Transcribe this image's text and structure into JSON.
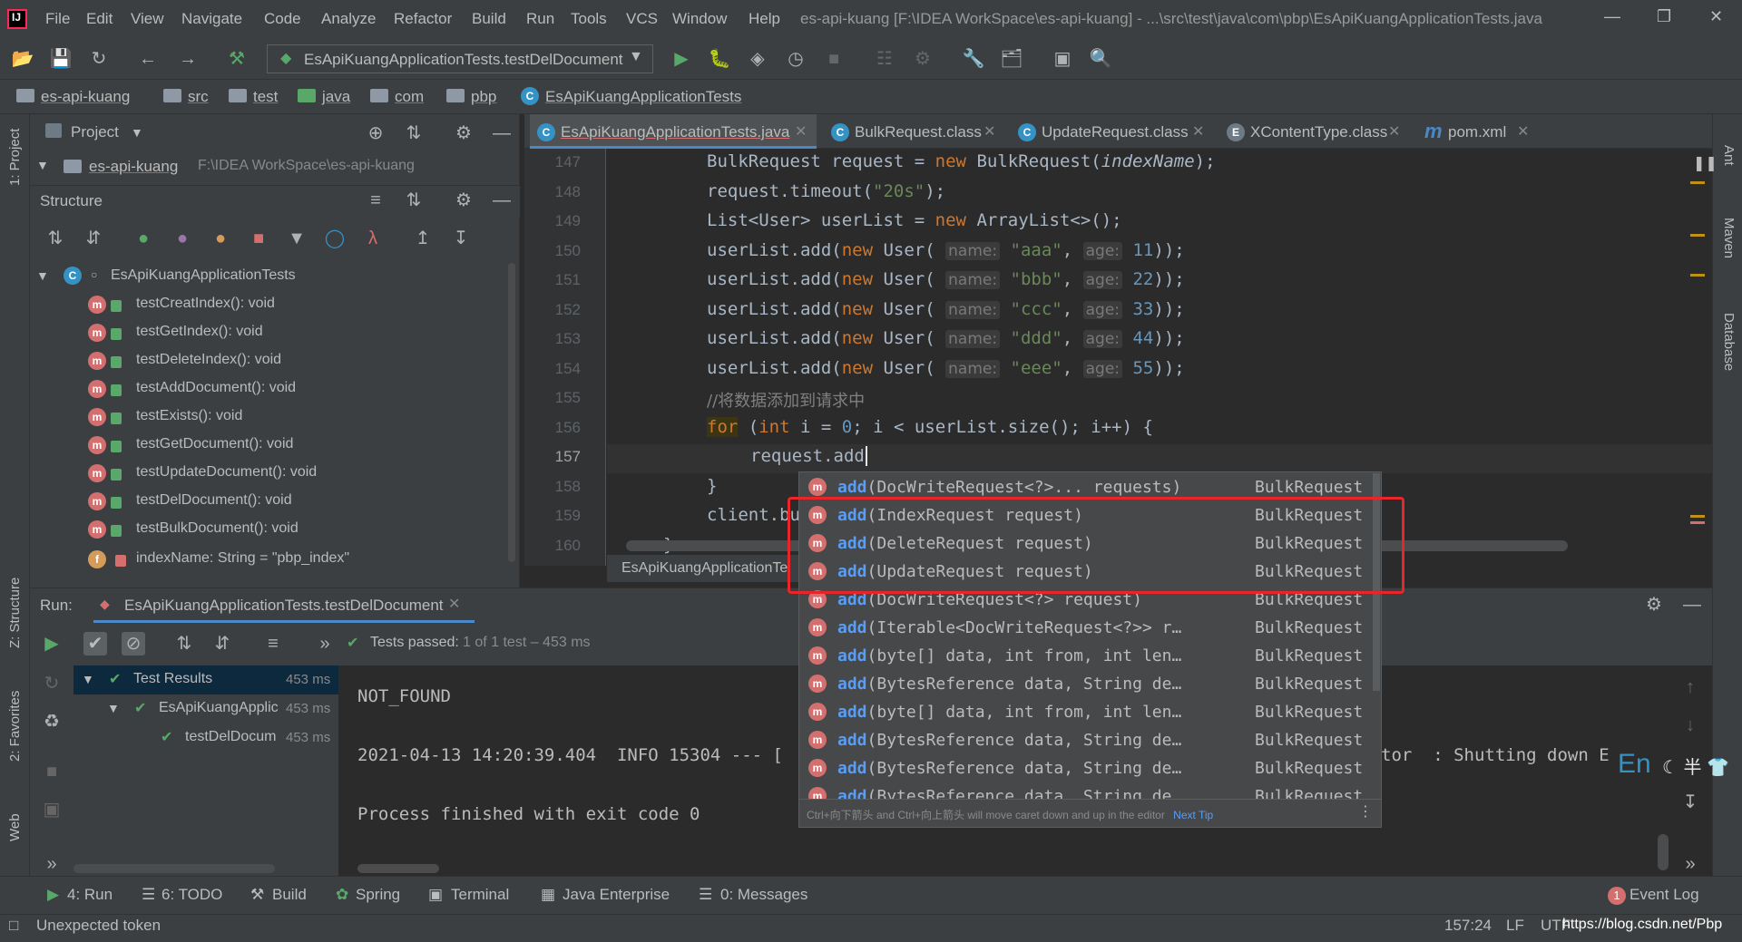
{
  "menu": {
    "items": [
      "File",
      "Edit",
      "View",
      "Navigate",
      "Code",
      "Analyze",
      "Refactor",
      "Build",
      "Run",
      "Tools",
      "VCS",
      "Window",
      "Help"
    ],
    "window_title": "es-api-kuang [F:\\IDEA WorkSpace\\es-api-kuang] - ...\\src\\test\\java\\com\\pbp\\EsApiKuangApplicationTests.java"
  },
  "toolbar": {
    "run_config": "EsApiKuangApplicationTests.testDelDocument"
  },
  "breadcrumb": [
    "es-api-kuang",
    "src",
    "test",
    "java",
    "com",
    "pbp",
    "EsApiKuangApplicationTests"
  ],
  "left_stripe": {
    "project": "1: Project",
    "structure": "Z: Structure",
    "favorites": "2: Favorites",
    "web": "Web"
  },
  "right_stripe": {
    "ant": "Ant",
    "maven": "Maven",
    "database": "Database"
  },
  "project_panel": {
    "title": "Project",
    "root_name": "es-api-kuang",
    "root_path": "F:\\IDEA WorkSpace\\es-api-kuang",
    "structure_title": "Structure",
    "class_name": "EsApiKuangApplicationTests",
    "methods": [
      "testCreatIndex(): void",
      "testGetIndex(): void",
      "testDeleteIndex(): void",
      "testAddDocument(): void",
      "testExists(): void",
      "testGetDocument(): void",
      "testUpdateDocument(): void",
      "testDelDocument(): void",
      "testBulkDocument(): void"
    ],
    "field": "indexName: String = \"pbp_index\""
  },
  "editor": {
    "tabs": [
      "EsApiKuangApplicationTests.java",
      "BulkRequest.class",
      "UpdateRequest.class",
      "XContentType.class",
      "pom.xml"
    ],
    "line_numbers": [
      "147",
      "148",
      "149",
      "150",
      "151",
      "152",
      "153",
      "154",
      "155",
      "156",
      "157",
      "158",
      "159",
      "160"
    ],
    "crumb": "EsApiKuangApplicationTe"
  },
  "completion": {
    "type": "BulkRequest",
    "method": "add",
    "items": [
      "(DocWriteRequest<?>... requests)",
      "(IndexRequest request)",
      "(DeleteRequest request)",
      "(UpdateRequest request)",
      "(DocWriteRequest<?> request)",
      "(Iterable<DocWriteRequest<?>> r…",
      "(byte[] data, int from, int len…",
      "(BytesReference data, String de…",
      "(byte[] data, int from, int len…",
      "(BytesReference data, String de…",
      "(BytesReference data, String de…",
      "(BytesReference data, String de…"
    ],
    "footer": "Ctrl+向下箭头 and Ctrl+向上箭头 will move caret down and up in the editor",
    "next_tip": "Next Tip"
  },
  "run": {
    "label": "Run:",
    "tab": "EsApiKuangApplicationTests.testDelDocument",
    "passed": "Tests passed:",
    "passed_count": "1 of 1 test – 453 ms",
    "tree": [
      {
        "name": "Test Results",
        "time": "453 ms"
      },
      {
        "name": "EsApiKuangApplic",
        "time": "453 ms"
      },
      {
        "name": "testDelDocum",
        "time": "453 ms"
      }
    ],
    "console": [
      "NOT_FOUND",
      "2021-04-13 14:20:39.404  INFO 15304 --- [",
      "tor  : Shutting down E",
      "Process finished with exit code 0"
    ]
  },
  "bottom_tools": [
    "4: Run",
    "6: TODO",
    "Build",
    "Spring",
    "Terminal",
    "Java Enterprise",
    "0: Messages",
    "Event Log"
  ],
  "event_count": "1",
  "status": {
    "message": "Unexpected token",
    "position": "157:24",
    "line_sep": "LF",
    "encoding": "UTF",
    "watermark": "https://blog.csdn.net/Pbp"
  },
  "ime": {
    "lang": "En"
  },
  "colors": {
    "accent": "#4a88c7",
    "highlight_box": "#e8262a",
    "method_icon": "#d46f6f",
    "keyword": "#cc7832",
    "string": "#6a8759",
    "number": "#6897bb"
  }
}
